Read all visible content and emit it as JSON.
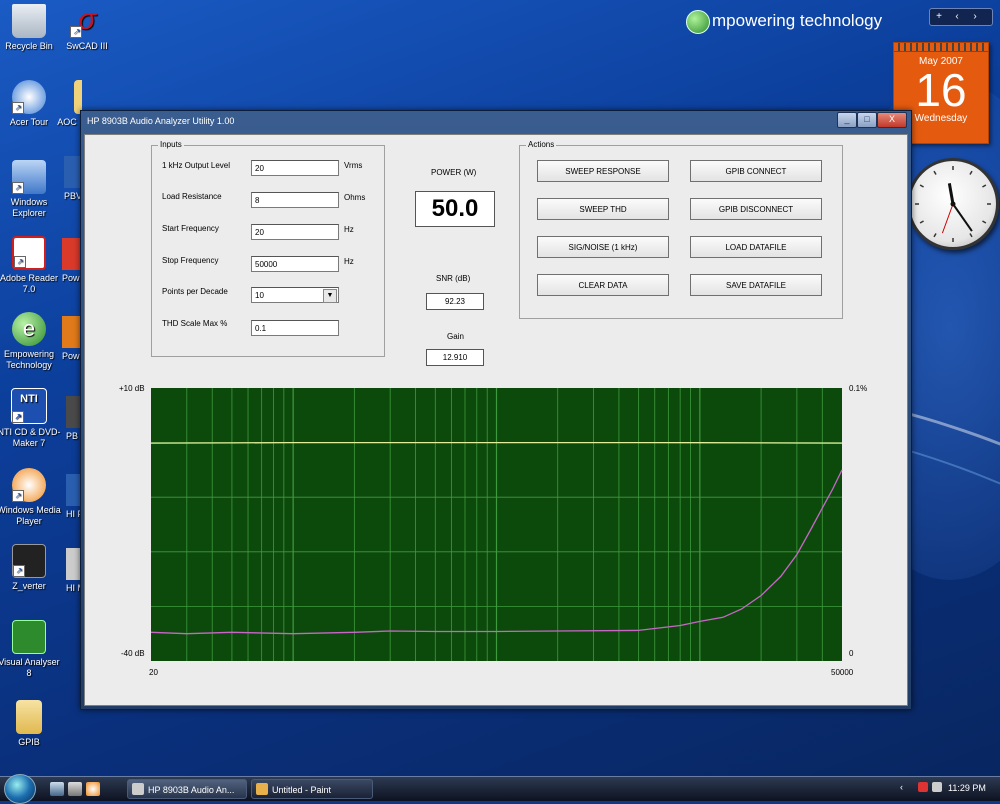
{
  "desktop": {
    "icons": [
      {
        "id": "recycle",
        "label": "Recycle Bin",
        "icon": "recycle-bin-icon",
        "color": "#c9d4df"
      },
      {
        "id": "swcad",
        "label": "SwCAD III",
        "icon": "swcad-icon",
        "color": "#c0162a"
      },
      {
        "id": "acertour",
        "label": "Acer Tour",
        "icon": "acer-tour-icon",
        "color": "#3a7bd5"
      },
      {
        "id": "aoc",
        "label": "AOC",
        "icon": "folder-icon",
        "color": "#e8c76a"
      },
      {
        "id": "winexplorer",
        "label": "Windows Explorer",
        "icon": "windows-explorer-icon",
        "color": "#5b8fd6"
      },
      {
        "id": "adobe",
        "label": "Adobe Reader 7.0",
        "icon": "adobe-reader-icon",
        "color": "#d21d1d"
      },
      {
        "id": "empowering",
        "label": "Empowering Technology",
        "icon": "empowering-technology-icon",
        "color": "#3aa53a"
      },
      {
        "id": "nti",
        "label": "NTI CD & DVD-Maker 7",
        "icon": "nti-icon",
        "color": "#1d4fb0"
      },
      {
        "id": "wmp",
        "label": "Windows Media Player",
        "icon": "media-player-icon",
        "color": "#f08a1d"
      },
      {
        "id": "zverter",
        "label": "Z_verter",
        "icon": "speaker-icon",
        "color": "#222"
      },
      {
        "id": "visual",
        "label": "Visual Analyser 8",
        "icon": "visual-analyser-icon",
        "color": "#2d8a2d"
      },
      {
        "id": "gpib",
        "label": "GPIB",
        "icon": "folder-icon",
        "color": "#e8c76a"
      }
    ],
    "partial_icons": [
      {
        "label": "PBV",
        "color": "#2a5fb0"
      },
      {
        "label": "Pow",
        "color": "#d93a2a"
      },
      {
        "label": "Pow For",
        "color": "#e07a1a"
      },
      {
        "label": "PB F",
        "color": "#4a4a4a"
      },
      {
        "label": "HI Po",
        "color": "#2a5fb0"
      },
      {
        "label": "HI M",
        "color": "#999"
      }
    ]
  },
  "widgets": {
    "brand_text": "mpowering technology",
    "calendar": {
      "month": "May 2007",
      "day": "16",
      "weekday": "Wednesday"
    },
    "clock": {
      "hour_deg": -10,
      "minute_deg": 145,
      "second_deg": 200
    }
  },
  "window": {
    "title": "HP 8903B Audio Analyzer Utility 1.00",
    "controls": {
      "minimize": "_",
      "maximize": "□",
      "close": "X"
    }
  },
  "inputs": {
    "group_label": "Inputs",
    "fields": [
      {
        "id": "output-level",
        "label": "1 kHz Output Level",
        "value": "20",
        "unit": "Vrms"
      },
      {
        "id": "load-resistance",
        "label": "Load Resistance",
        "value": "8",
        "unit": "Ohms"
      },
      {
        "id": "start-frequency",
        "label": "Start Frequency",
        "value": "20",
        "unit": "Hz"
      },
      {
        "id": "stop-frequency",
        "label": "Stop Frequency",
        "value": "50000",
        "unit": "Hz"
      }
    ],
    "points_per_decade": {
      "label": "Points per Decade",
      "value": "10"
    },
    "thd_scale": {
      "label": "THD Scale Max %",
      "value": "0.1"
    }
  },
  "readouts": {
    "power": {
      "label": "POWER (W)",
      "value": "50.0"
    },
    "snr": {
      "label": "SNR (dB)",
      "value": "92.23"
    },
    "gain": {
      "label": "Gain",
      "value": "12.910"
    }
  },
  "actions": {
    "group_label": "Actions",
    "buttons": [
      {
        "id": "sweep-response",
        "label": "SWEEP RESPONSE"
      },
      {
        "id": "gpib-connect",
        "label": "GPIB CONNECT"
      },
      {
        "id": "sweep-thd",
        "label": "SWEEP THD"
      },
      {
        "id": "gpib-disconnect",
        "label": "GPIB DISCONNECT"
      },
      {
        "id": "sig-noise",
        "label": "SIG/NOISE (1 kHz)"
      },
      {
        "id": "load-datafile",
        "label": "LOAD DATAFILE"
      },
      {
        "id": "clear-data",
        "label": "CLEAR DATA"
      },
      {
        "id": "save-datafile",
        "label": "SAVE DATAFILE"
      }
    ]
  },
  "chart_data": {
    "type": "line",
    "x_scale": "log",
    "xlim": [
      20,
      50000
    ],
    "x_tick_labels": [
      "20",
      "50000"
    ],
    "left_axis": {
      "top": "+10 dB",
      "bottom": "-40 dB",
      "ylim": [
        -40,
        10
      ]
    },
    "right_axis": {
      "top": "0.1%",
      "bottom": "0",
      "ylim": [
        0,
        0.1
      ]
    },
    "background": "#0c4a0c",
    "grid_color": "#3f9a3f",
    "grid": true,
    "series": [
      {
        "axis": "left",
        "color": "#e4ee9a",
        "x": [
          20,
          50,
          100,
          200,
          500,
          1000,
          2000,
          5000,
          10000,
          20000,
          30000,
          50000
        ],
        "y": [
          -0.1,
          -0.05,
          0.0,
          0.0,
          0.0,
          0.0,
          0.0,
          0.0,
          -0.02,
          -0.05,
          -0.08,
          -0.1
        ]
      },
      {
        "axis": "right",
        "color": "#c867c8",
        "x": [
          20,
          30,
          50,
          100,
          200,
          300,
          500,
          1000,
          2000,
          5000,
          8000,
          10000,
          13000,
          16000,
          20000,
          25000,
          30000,
          35000,
          40000,
          45000,
          50000
        ],
        "y": [
          0.0105,
          0.01,
          0.0105,
          0.01,
          0.0105,
          0.011,
          0.0108,
          0.0108,
          0.011,
          0.0112,
          0.013,
          0.0145,
          0.016,
          0.019,
          0.024,
          0.031,
          0.039,
          0.048,
          0.056,
          0.063,
          0.07
        ]
      }
    ]
  },
  "taskbar": {
    "tasks": [
      {
        "id": "hp-analyzer",
        "label": "HP 8903B Audio An...",
        "active": true
      },
      {
        "id": "paint",
        "label": "Untitled - Paint",
        "active": false
      }
    ],
    "time": "11:29 PM"
  }
}
